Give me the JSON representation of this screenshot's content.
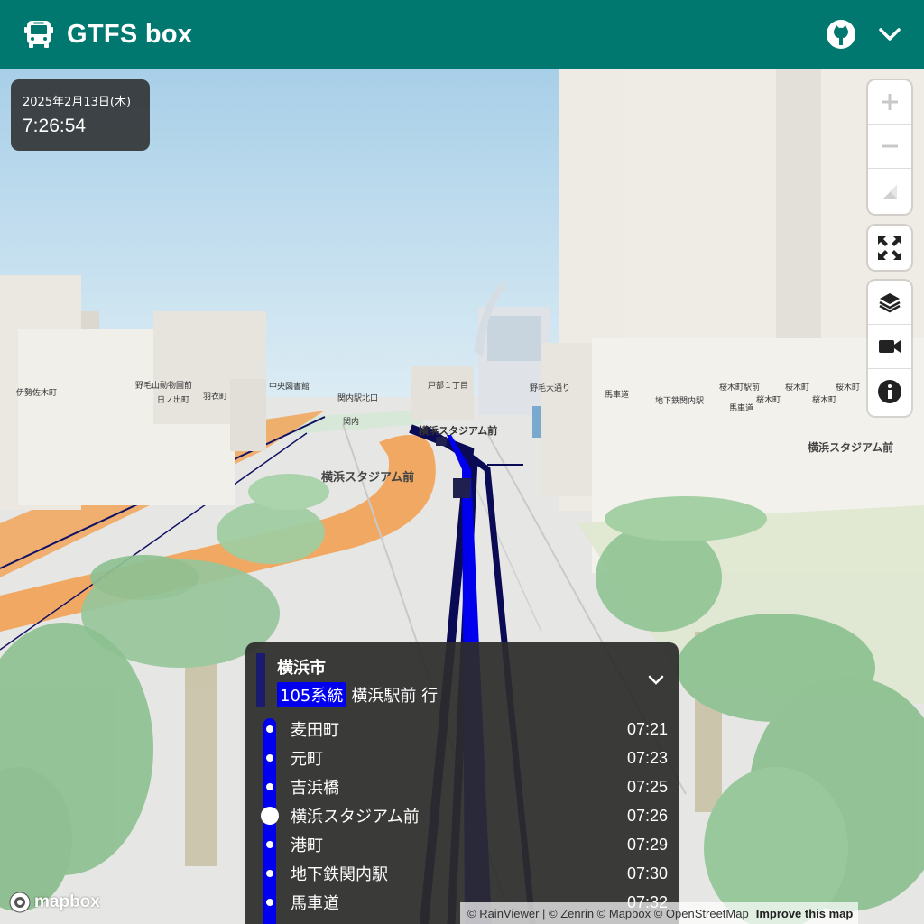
{
  "app": {
    "title": "GTFS box"
  },
  "clock": {
    "date": "2025年2月13日(木)",
    "time": "7:26:54"
  },
  "map_labels": {
    "isezakicho": "伊勢佐木町",
    "nogeyama_zoo": "野毛山動物園前",
    "hinodecho": "日ノ出町",
    "hagoromocho": "羽衣町",
    "chuo_library": "中央図書館",
    "kannai_north": "関内駅北口",
    "kannai": "関内",
    "tobe_1": "戸部１丁目",
    "nogeodori": "野毛大通り",
    "bashamichi": "馬車道",
    "subway_kannai": "地下鉄関内駅",
    "sakuragicho_st": "桜木町駅前",
    "sakuragicho_a": "桜木町",
    "sakuragicho_b": "桜木町",
    "sakuragicho_c": "桜木町",
    "sakuragicho_d": "桜木町",
    "bashamichi2": "馬車道",
    "stadium_center": "横浜スタジアム前",
    "stadium_track": "横浜スタジアム前",
    "stadium_right": "横浜スタジアム前"
  },
  "trip": {
    "agency": "横浜市",
    "route_name": "105系統",
    "headsign": "横浜駅前 行",
    "route_color": "#0000ee",
    "stops": [
      {
        "name": "麦田町",
        "time": "07:21",
        "current": false
      },
      {
        "name": "元町",
        "time": "07:23",
        "current": false
      },
      {
        "name": "吉浜橋",
        "time": "07:25",
        "current": false
      },
      {
        "name": "横浜スタジアム前",
        "time": "07:26",
        "current": true
      },
      {
        "name": "港町",
        "time": "07:29",
        "current": false
      },
      {
        "name": "地下鉄関内駅",
        "time": "07:30",
        "current": false
      },
      {
        "name": "馬車道",
        "time": "07:32",
        "current": false
      }
    ]
  },
  "attribution": {
    "text": "© RainViewer | © Zenrin © Mapbox © OpenStreetMap",
    "improve": "Improve this map"
  },
  "mapbox_logo": "mapbox",
  "colors": {
    "header": "#00786f",
    "route": "#0000ee",
    "route_dark": "#101060",
    "roads": "#f0a860"
  }
}
